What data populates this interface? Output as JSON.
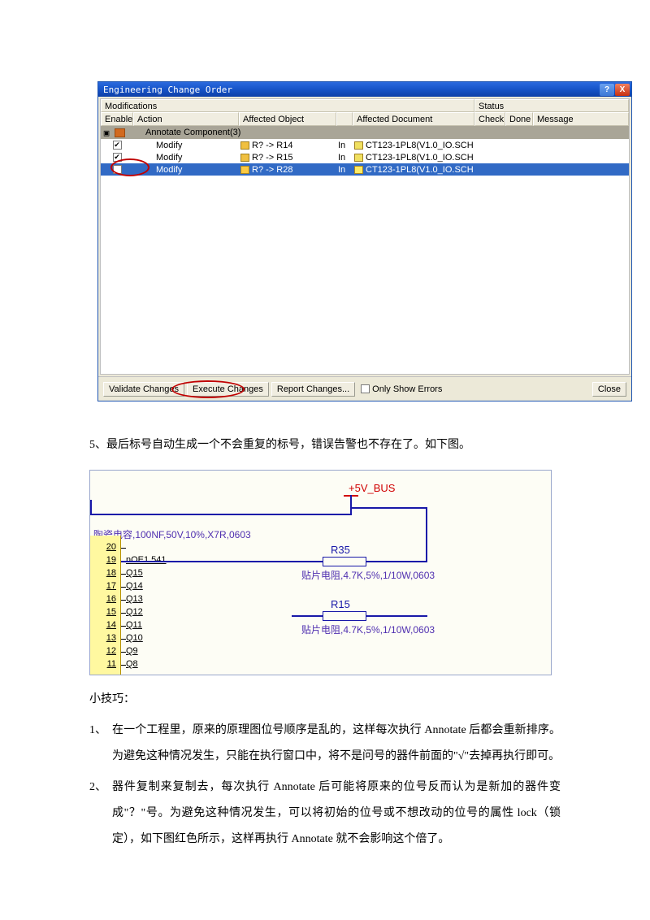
{
  "eco": {
    "title": "Engineering Change Order",
    "superheaders": {
      "modifications": "Modifications",
      "status": "Status"
    },
    "headers": {
      "enable": "Enable",
      "action": "Action",
      "affected_object": "Affected Object",
      "affected_document": "Affected Document",
      "check": "Check",
      "done": "Done",
      "message": "Message"
    },
    "group_label": "Annotate Component(3)",
    "rows": [
      {
        "checked": true,
        "action": "Modify",
        "obj": "R? -> R14",
        "in": "In",
        "doc": "CT123-1PL8(V1.0_IO.SCH",
        "selected": false
      },
      {
        "checked": true,
        "action": "Modify",
        "obj": "R? -> R15",
        "in": "In",
        "doc": "CT123-1PL8(V1.0_IO.SCH",
        "selected": false
      },
      {
        "checked": false,
        "action": "Modify",
        "obj": "R? -> R28",
        "in": "In",
        "doc": "CT123-1PL8(V1.0_IO.SCH",
        "selected": true
      }
    ],
    "footer": {
      "validate": "Validate Changes",
      "execute": "Execute Changes",
      "report": "Report Changes...",
      "only_errors": "Only Show Errors",
      "close": "Close"
    }
  },
  "paragraph5": "5、最后标号自动生成一个不会重复的标号，错误告警也不存在了。如下图。",
  "schematic": {
    "net": "+5V_BUS",
    "cap": "陶瓷电容,100NF,50V,10%,X7R,0603",
    "r1_des": "R35",
    "r1_val": "贴片电阻,4.7K,5%,1/10W,0603",
    "r2_des": "R15",
    "r2_val": "贴片电阻,4.7K,5%,1/10W,0603",
    "pins": [
      {
        "num": "20",
        "name": ""
      },
      {
        "num": "19",
        "name": "nOE1  541"
      },
      {
        "num": "18",
        "name": "Q15"
      },
      {
        "num": "17",
        "name": "Q14"
      },
      {
        "num": "16",
        "name": "Q13"
      },
      {
        "num": "15",
        "name": "Q12"
      },
      {
        "num": "14",
        "name": "Q11"
      },
      {
        "num": "13",
        "name": "Q10"
      },
      {
        "num": "12",
        "name": "Q9"
      },
      {
        "num": "11",
        "name": "Q8"
      }
    ]
  },
  "tips_title": "小技巧：",
  "tips": [
    "在一个工程里，原来的原理图位号顺序是乱的，这样每次执行 Annotate 后都会重新排序。为避免这种情况发生，只能在执行窗口中，将不是问号的器件前面的\"√\"去掉再执行即可。",
    "器件复制来复制去，每次执行 Annotate 后可能将原来的位号反而认为是新加的器件变成\"？\"号。为避免这种情况发生，可以将初始的位号或不想改动的位号的属性 lock（锁定），如下图红色所示，这样再执行 Annotate 就不会影响这个倍了。"
  ]
}
